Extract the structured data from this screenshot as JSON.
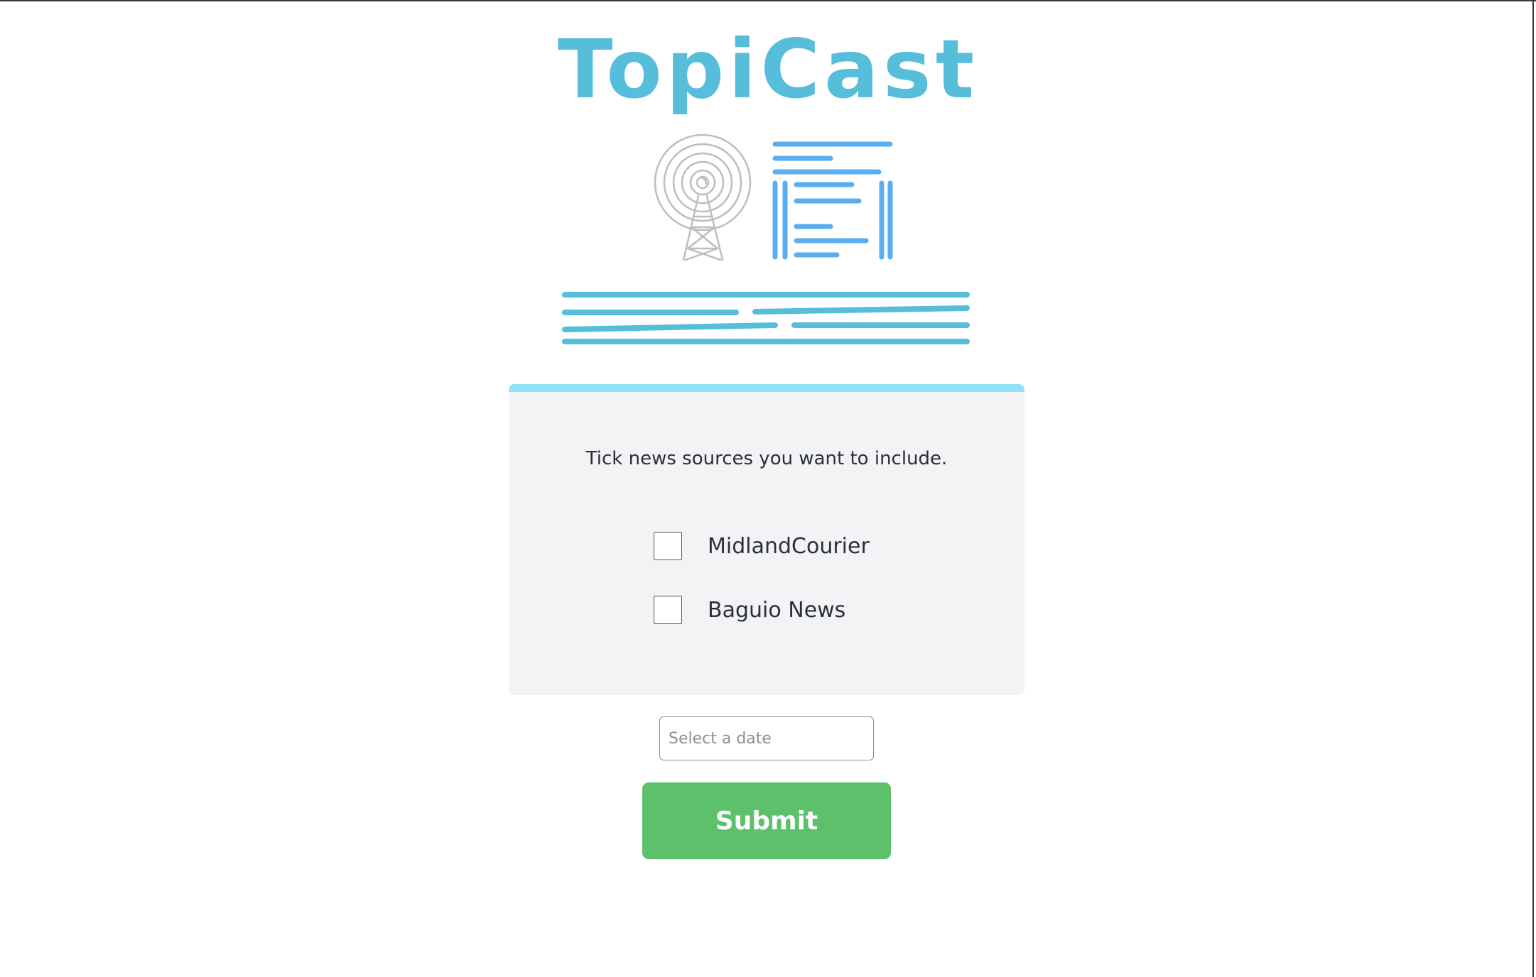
{
  "app": {
    "title": "TopiCast"
  },
  "sources": {
    "prompt": "Tick news sources you want to include.",
    "items": [
      {
        "label": "MidlandCourier",
        "checked": false
      },
      {
        "label": "Baguio News",
        "checked": false
      }
    ]
  },
  "date": {
    "placeholder": "Select a date",
    "value": ""
  },
  "actions": {
    "submit_label": "Submit"
  },
  "colors": {
    "brand": "#56bddb",
    "news_icon": "#5aaef0",
    "tower_icon": "#bdbdbd",
    "card_accent": "#90e3f4",
    "card_bg": "#f2f3f5",
    "submit_bg": "#5cc16a"
  },
  "icons": {
    "broadcast": "broadcast-tower-icon",
    "newspaper": "newspaper-icon"
  }
}
